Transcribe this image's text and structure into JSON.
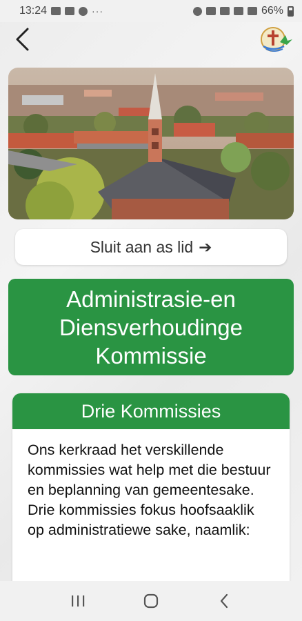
{
  "status_bar": {
    "time": "13:24",
    "dots": "···",
    "battery": "66%"
  },
  "header": {
    "back_icon": "chevron-left-icon",
    "logo_icon": "church-logo-icon"
  },
  "colors": {
    "accent_green": "#2a9443",
    "card_bg": "#ffffff",
    "page_bg": "#f0f0f0"
  },
  "join": {
    "label": "Sluit aan as lid",
    "arrow": "➔"
  },
  "banner": {
    "line1": "Administrasie-en",
    "line2": "Diensverhoudinge",
    "line3": "Kommissie"
  },
  "card": {
    "title": "Drie Kommissies",
    "paragraph1": "Ons kerkraad het verskillende kommissies wat help met die bestuur en beplanning van gemeentesake.",
    "paragraph2": "Drie kommissies fokus hoofsaaklik op administratiewe sake, naamlik:"
  },
  "nav": {
    "recents_icon": "recent-apps-icon",
    "home_icon": "home-icon",
    "back_icon": "back-icon"
  }
}
